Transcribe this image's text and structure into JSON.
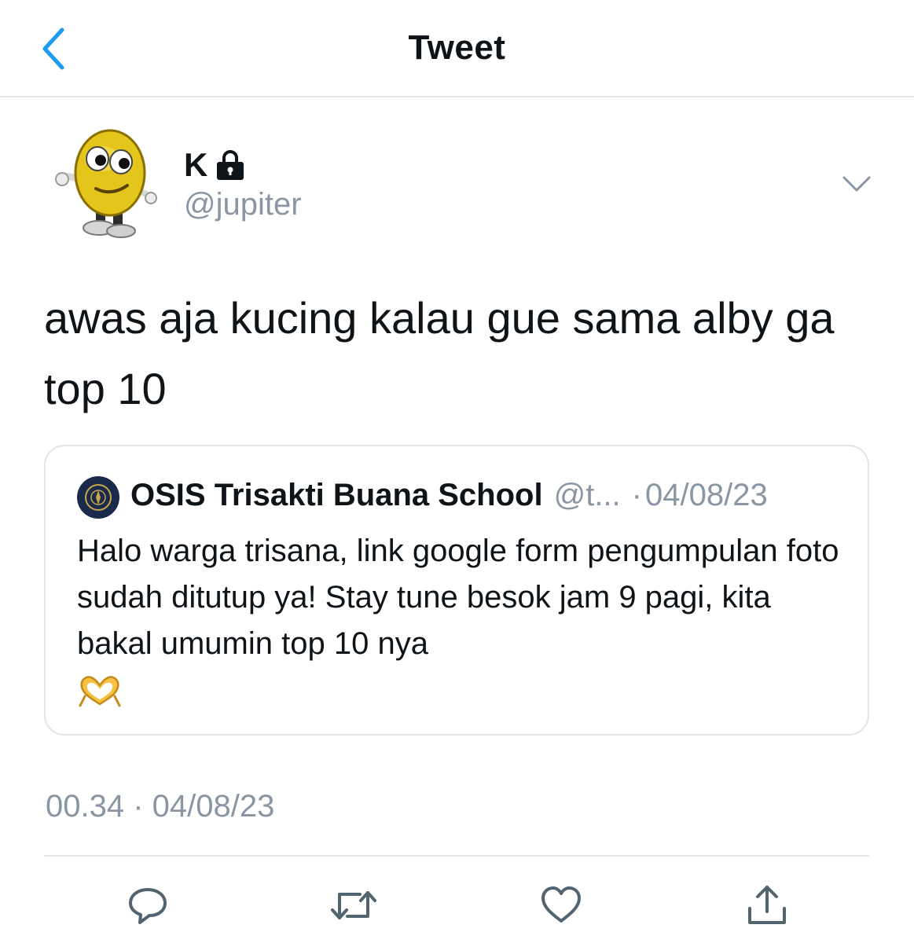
{
  "header": {
    "title": "Tweet",
    "back_icon": "chevron-left-icon"
  },
  "author": {
    "name": "K",
    "handle": "@jupiter",
    "protected_icon": "lock-icon",
    "avatar": "emoji-character-avatar"
  },
  "tweet": {
    "text": "awas aja kucing kalau gue sama alby ga top 10",
    "timestamp": "00.34 · 04/08/23"
  },
  "quote": {
    "name": "OSIS Trisakti Buana School",
    "handle": "@t...",
    "dot": "·",
    "date": "04/08/23",
    "text": "Halo warga trisana, link google form pengumpulan foto sudah ditutup ya! Stay tune besok jam 9 pagi, kita bakal umumin top 10 nya",
    "emoji": "heart-hands-emoji"
  },
  "actions": [
    "reply-icon",
    "retweet-icon",
    "like-icon",
    "share-icon"
  ],
  "colors": {
    "accent": "#1d9bf0",
    "text": "#0f1419",
    "secondary": "#8a96a3",
    "border": "#e1e4e8"
  }
}
